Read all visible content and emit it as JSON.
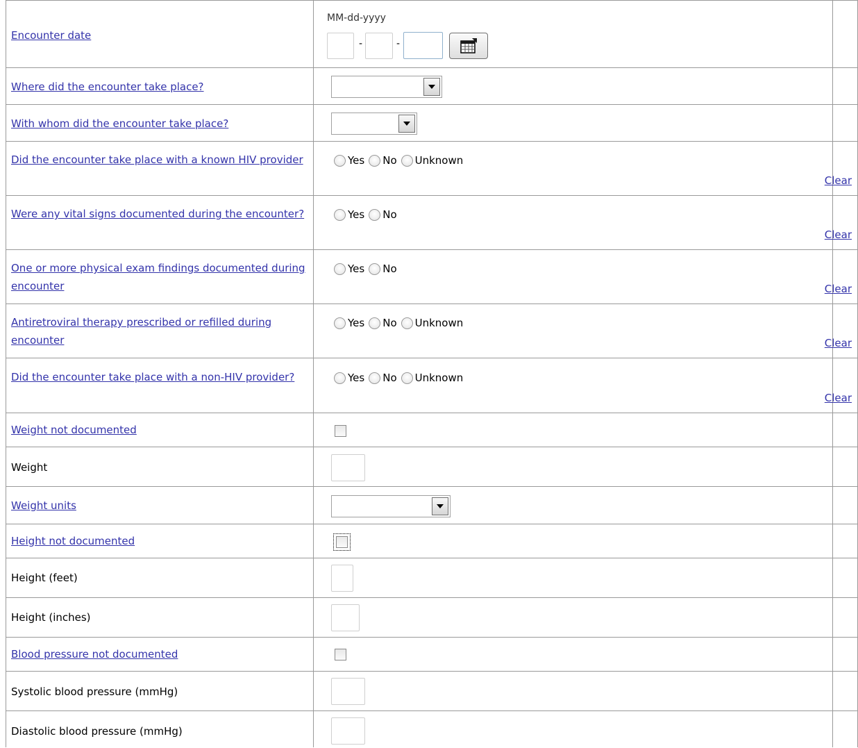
{
  "colors": {
    "link": "#3333aa",
    "grid": "#999999",
    "input_border": "#cfcfcf"
  },
  "date_format_hint": "MM-dd-yyyy",
  "date_separator": "-",
  "calendar_icon": "calendar-icon",
  "radio_labels": {
    "yes": "Yes",
    "no": "No",
    "unknown": "Unknown"
  },
  "clear_label": "Clear",
  "fields": {
    "encounter_date": "Encounter date",
    "location": "Where did the encounter take place?",
    "with_whom": "With whom did the encounter take place?",
    "hiv_provider": "Did the encounter take place with a known HIV provider",
    "vital_signs": "Were any vital signs documented during the encounter?",
    "physical_exam": "One or more physical exam findings documented during encounter",
    "antiretroviral": "Antiretroviral therapy prescribed or refilled during encounter",
    "non_hiv_provider": "Did the encounter take place with a non-HIV provider?",
    "weight_not_documented": "Weight not documented",
    "weight": "Weight",
    "weight_units": "Weight units",
    "height_not_documented": "Height not documented",
    "height_feet": "Height (feet)",
    "height_inches": "Height (inches)",
    "bp_not_documented": "Blood pressure not documented",
    "systolic": "Systolic blood pressure (mmHg)",
    "diastolic": "Diastolic blood pressure (mmHg)"
  }
}
